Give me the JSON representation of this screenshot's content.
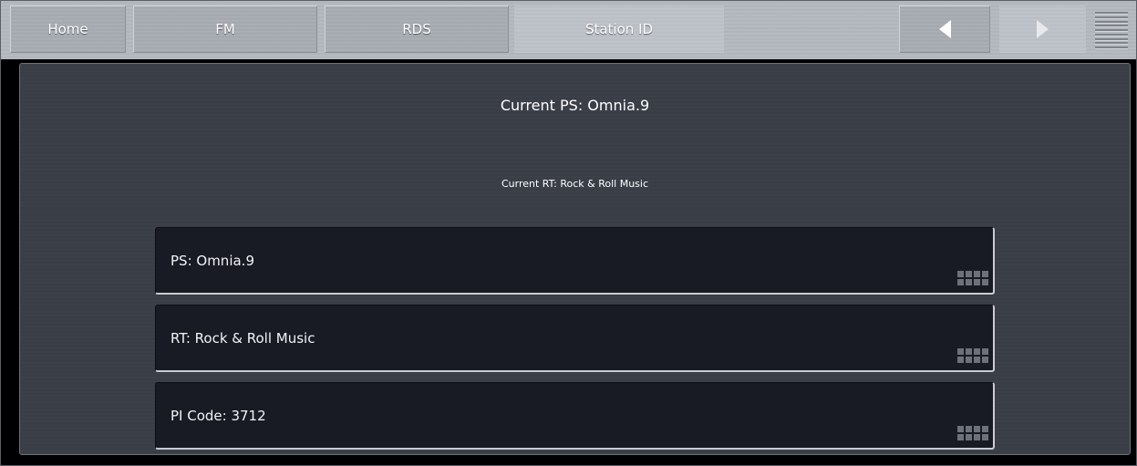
{
  "nav": {
    "home": "Home",
    "fm": "FM",
    "rds": "RDS",
    "station_id": "Station ID",
    "back_icon": "chevron-left-icon",
    "forward_icon": "chevron-right-icon",
    "menu_icon": "hamburger-menu-icon"
  },
  "status": {
    "current_ps": "Current PS: Omnia.9",
    "current_rt": "Current RT: Rock & Roll Music"
  },
  "fields": [
    {
      "label": "PS: Omnia.9",
      "icon": "keypad-icon"
    },
    {
      "label": "RT: Rock & Roll Music",
      "icon": "keypad-icon"
    },
    {
      "label": "PI Code: 3712",
      "icon": "keypad-icon"
    }
  ],
  "colors": {
    "topbar": "#b7bcc2",
    "panel": "#3b4049",
    "field_bg": "#181b24",
    "text": "#ffffff"
  }
}
